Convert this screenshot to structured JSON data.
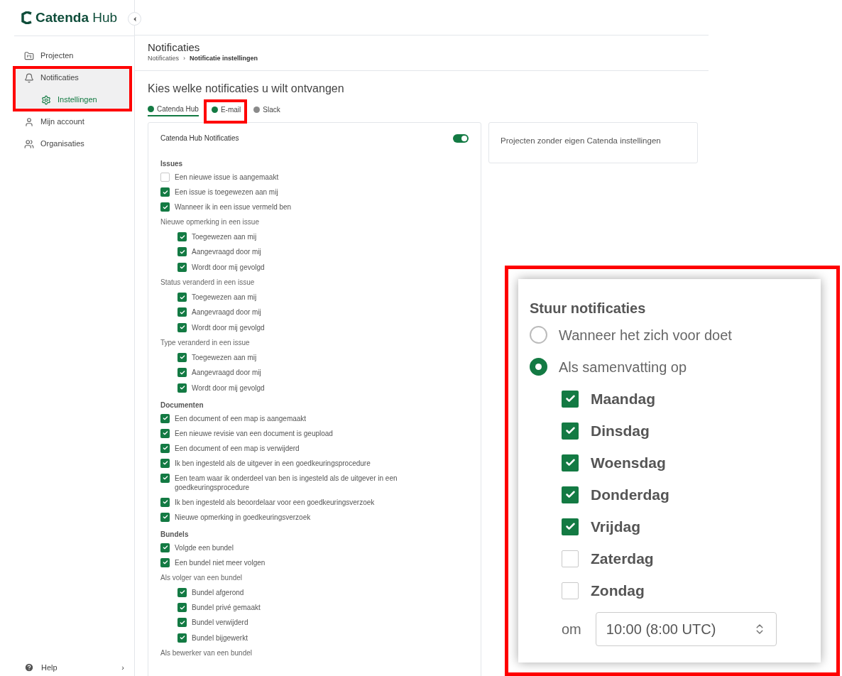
{
  "logo": {
    "brand": "Catenda",
    "product": "Hub"
  },
  "sidebar": {
    "items": [
      {
        "label": "Projecten",
        "kind": "projects",
        "selected": false,
        "highlighted": false
      },
      {
        "label": "Notificaties",
        "kind": "bell",
        "selected": false,
        "highlighted": true,
        "children": [
          {
            "label": "Instellingen",
            "kind": "settings",
            "selected": true
          }
        ]
      },
      {
        "label": "Mijn account",
        "kind": "user",
        "selected": false,
        "highlighted": false
      },
      {
        "label": "Organisaties",
        "kind": "users",
        "selected": false,
        "highlighted": false
      }
    ],
    "help": {
      "label": "Help",
      "arrow": "›"
    }
  },
  "header": {
    "title": "Notificaties",
    "breadcrumb": [
      "Notificaties",
      "Notificatie instellingen"
    ],
    "separator": "›"
  },
  "heading": "Kies welke notificaties u wilt ontvangen",
  "tabs": [
    {
      "label": "Catenda Hub",
      "selected": true,
      "color": "#137a43"
    },
    {
      "label": "E-mail",
      "selected": false,
      "color": "#137a43"
    },
    {
      "label": "Slack",
      "selected": false,
      "color": "#8a8a8a"
    }
  ],
  "card": {
    "title": "Catenda Hub Notificaties",
    "on": true,
    "sections": [
      {
        "heading": "Issues",
        "items": [
          {
            "kind": "checkbox",
            "label": "Een nieuwe issue is aangemaakt",
            "checked": false
          },
          {
            "kind": "checkbox",
            "label": "Een issue is toegewezen aan mij",
            "checked": true
          },
          {
            "kind": "checkbox",
            "label": "Wanneer ik in een issue vermeld ben",
            "checked": true
          },
          {
            "kind": "group",
            "label": "Nieuwe opmerking in een issue",
            "children": [
              {
                "label": "Toegewezen aan mij",
                "checked": true
              },
              {
                "label": "Aangevraagd door mij",
                "checked": true
              },
              {
                "label": "Wordt door mij gevolgd",
                "checked": true
              }
            ]
          },
          {
            "kind": "group",
            "label": "Status veranderd in een issue",
            "children": [
              {
                "label": "Toegewezen aan mij",
                "checked": true
              },
              {
                "label": "Aangevraagd door mij",
                "checked": true
              },
              {
                "label": "Wordt door mij gevolgd",
                "checked": true
              }
            ]
          },
          {
            "kind": "group",
            "label": "Type veranderd in een issue",
            "children": [
              {
                "label": "Toegewezen aan mij",
                "checked": true
              },
              {
                "label": "Aangevraagd door mij",
                "checked": true
              },
              {
                "label": "Wordt door mij gevolgd",
                "checked": true
              }
            ]
          }
        ]
      },
      {
        "heading": "Documenten",
        "items": [
          {
            "kind": "checkbox",
            "label": "Een document of een map is aangemaakt",
            "checked": true
          },
          {
            "kind": "checkbox",
            "label": "Een nieuwe revisie van een document is geupload",
            "checked": true
          },
          {
            "kind": "checkbox",
            "label": "Een document of een map is verwijderd",
            "checked": true
          },
          {
            "kind": "checkbox",
            "label": "Ik ben ingesteld als de uitgever in een goedkeuringsprocedure",
            "checked": true
          },
          {
            "kind": "checkbox",
            "label": "Een team waar ik onderdeel van ben is ingesteld als de uitgever in een goedkeuringsprocedure",
            "checked": true
          },
          {
            "kind": "checkbox",
            "label": "Ik ben ingesteld als beoordelaar voor een goedkeuringsverzoek",
            "checked": true
          },
          {
            "kind": "checkbox",
            "label": "Nieuwe opmerking in goedkeuringsverzoek",
            "checked": true
          }
        ]
      },
      {
        "heading": "Bundels",
        "items": [
          {
            "kind": "checkbox",
            "label": "Volgde een bundel",
            "checked": true
          },
          {
            "kind": "checkbox",
            "label": "Een bundel niet meer volgen",
            "checked": true
          },
          {
            "kind": "group",
            "label": "Als volger van een bundel",
            "children": [
              {
                "label": "Bundel afgerond",
                "checked": true
              },
              {
                "label": "Bundel privé gemaakt",
                "checked": true
              },
              {
                "label": "Bundel verwijderd",
                "checked": true
              },
              {
                "label": "Bundel bijgewerkt",
                "checked": true
              }
            ]
          },
          {
            "kind": "group",
            "label": "Als bewerker van een bundel"
          }
        ]
      }
    ]
  },
  "side_card": {
    "title": "Projecten zonder eigen Catenda instellingen"
  },
  "callout": {
    "heading": "Stuur notificaties",
    "options": [
      {
        "label": "Wanneer het zich voor doet",
        "selected": false
      },
      {
        "label": "Als samenvatting op",
        "selected": true
      }
    ],
    "days": [
      {
        "label": "Maandag",
        "checked": true
      },
      {
        "label": "Dinsdag",
        "checked": true
      },
      {
        "label": "Woensdag",
        "checked": true
      },
      {
        "label": "Donderdag",
        "checked": true
      },
      {
        "label": "Vrijdag",
        "checked": true
      },
      {
        "label": "Zaterdag",
        "checked": false
      },
      {
        "label": "Zondag",
        "checked": false
      }
    ],
    "time_label": "om",
    "time_value": "10:00 (8:00 UTC)"
  }
}
